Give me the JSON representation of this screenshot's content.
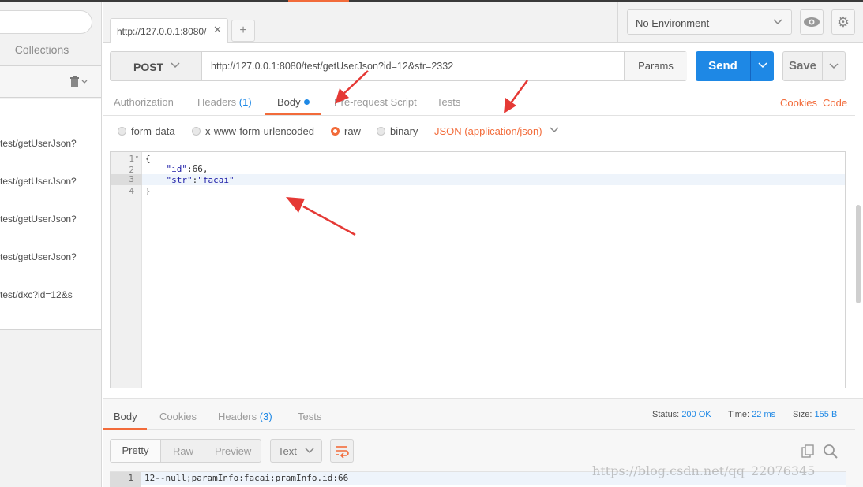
{
  "colors": {
    "accent": "#f26b3a",
    "primary": "#1e88e5",
    "panel": "#f2f2f2"
  },
  "sidebar": {
    "collections_label": "Collections",
    "history": [
      "test/getUserJson?",
      "test/getUserJson?",
      "test/getUserJson?",
      "test/getUserJson?",
      "test/dxc?id=12&s"
    ]
  },
  "tabs": {
    "request_tab_label": "http://127.0.0.1:8080/",
    "close_glyph": "✕",
    "add_glyph": "+"
  },
  "environment": {
    "selected": "No Environment"
  },
  "request": {
    "method": "POST",
    "url": "http://127.0.0.1:8080/test/getUserJson?id=12&str=2332",
    "params_label": "Params",
    "send_label": "Send",
    "save_label": "Save"
  },
  "request_tabs": {
    "authorization": "Authorization",
    "headers": "Headers",
    "headers_count": "(1)",
    "body": "Body",
    "prerequest": "Pre-request Script",
    "tests": "Tests",
    "cookies": "Cookies",
    "code": "Code"
  },
  "body_options": {
    "form_data": "form-data",
    "urlencoded": "x-www-form-urlencoded",
    "raw": "raw",
    "binary": "binary",
    "selected": "raw",
    "content_type": "JSON (application/json)"
  },
  "editor": {
    "line_numbers": [
      "1",
      "2",
      "3",
      "4"
    ],
    "line1": "{",
    "line2_key": "\"id\"",
    "line2_rest": ":66,",
    "line3_key": "\"str\"",
    "line3_colon": ":",
    "line3_val": "\"facai\"",
    "line4": "}"
  },
  "response": {
    "tabs": {
      "body": "Body",
      "cookies": "Cookies",
      "headers": "Headers",
      "headers_count": "(3)",
      "tests": "Tests"
    },
    "status_label": "Status:",
    "status_value": "200 OK",
    "time_label": "Time:",
    "time_value": "22 ms",
    "size_label": "Size:",
    "size_value": "155 B",
    "view_modes": {
      "pretty": "Pretty",
      "raw": "Raw",
      "preview": "Preview"
    },
    "format": "Text",
    "line_number": "1",
    "body_text": "12--null;paramInfo:facai;pramInfo.id:66"
  },
  "watermark": "https://blog.csdn.net/qq_22076345"
}
